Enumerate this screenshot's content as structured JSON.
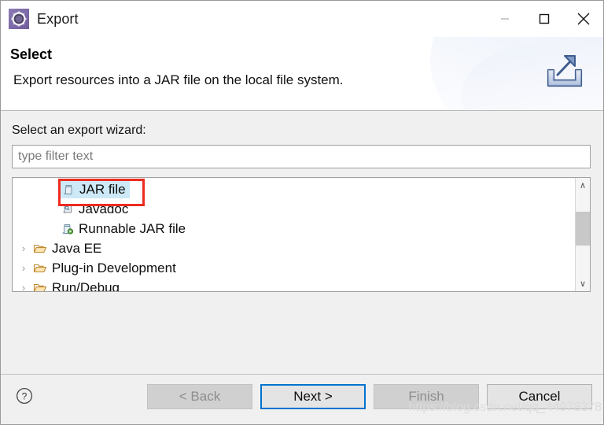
{
  "window": {
    "title": "Export",
    "icon": "export-wizard-gear-icon",
    "controls": {
      "minimize": "—",
      "maximize": "□",
      "close": "✕"
    }
  },
  "header": {
    "title": "Select",
    "description": "Export resources into a JAR file on the local file system.",
    "banner_icon": "export-tray-arrow-icon"
  },
  "body": {
    "field_label": "Select an export wizard:",
    "filter": {
      "value": "",
      "placeholder": "type filter text"
    },
    "tree": {
      "items": [
        {
          "label": "JAR file",
          "icon": "jar-file-icon",
          "type": "leaf",
          "indent": 1,
          "selected": true,
          "annotated": true
        },
        {
          "label": "Javadoc",
          "icon": "javadoc-icon",
          "type": "leaf",
          "indent": 1,
          "selected": false,
          "annotated": false
        },
        {
          "label": "Runnable JAR file",
          "icon": "runnable-jar-file-icon",
          "type": "leaf",
          "indent": 1,
          "selected": false,
          "annotated": false
        },
        {
          "label": "Java EE",
          "icon": "folder-icon",
          "type": "folder",
          "indent": 0,
          "selected": false,
          "annotated": false
        },
        {
          "label": "Plug-in Development",
          "icon": "folder-icon",
          "type": "folder",
          "indent": 0,
          "selected": false,
          "annotated": false
        },
        {
          "label": "Run/Debug",
          "icon": "folder-icon",
          "type": "folder",
          "indent": 0,
          "selected": false,
          "annotated": false
        }
      ],
      "twisty_collapsed": "›"
    },
    "scrollbar": {
      "up_arrow": "∧",
      "down_arrow": "∨"
    }
  },
  "footer": {
    "help_icon": "help-question-icon",
    "buttons": [
      {
        "label": "< Back",
        "state": "disabled"
      },
      {
        "label": "Next >",
        "state": "default"
      },
      {
        "label": "Finish",
        "state": "disabled"
      },
      {
        "label": "Cancel",
        "state": "enabled"
      }
    ]
  },
  "watermark": "https://blog.csdn.net/qq_44978378",
  "colors": {
    "selection": "#cde8f6",
    "annotation": "#ee2b20",
    "focus": "#0073cf",
    "dialog_bg": "#f0f0f0",
    "app_icon": "#7d6aa8"
  }
}
